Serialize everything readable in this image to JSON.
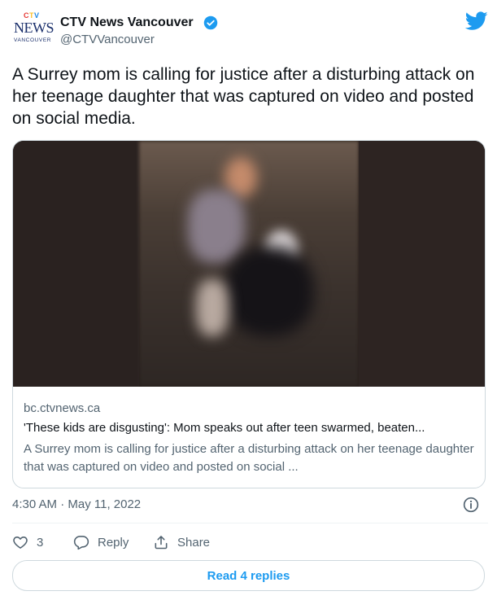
{
  "header": {
    "logo": {
      "ctv": "CTV",
      "news": "NEWS",
      "sub": "VANCOUVER"
    },
    "account_name": "CTV News Vancouver",
    "handle": "@CTVVancouver",
    "icons": {
      "verified": "verified-badge-icon",
      "brand": "twitter-bird-icon"
    }
  },
  "tweet": {
    "text": "A Surrey mom is calling for justice after a disturbing attack on her teenage daughter that was captured on video and posted on social media."
  },
  "card": {
    "domain": "bc.ctvnews.ca",
    "title": "'These kids are disgusting': Mom speaks out after teen swarmed, beaten...",
    "description": "A Surrey mom is calling for justice after a disturbing attack on her teenage daughter that was captured on video and posted on social ..."
  },
  "meta": {
    "timestamp": "4:30 AM · May 11, 2022"
  },
  "actions": {
    "likes_count": "3",
    "reply_label": "Reply",
    "share_label": "Share"
  },
  "footer": {
    "read_replies_label": "Read 4 replies"
  },
  "colors": {
    "accent": "#1d9bf0",
    "secondary_text": "#536471",
    "border": "#cfd9de"
  }
}
